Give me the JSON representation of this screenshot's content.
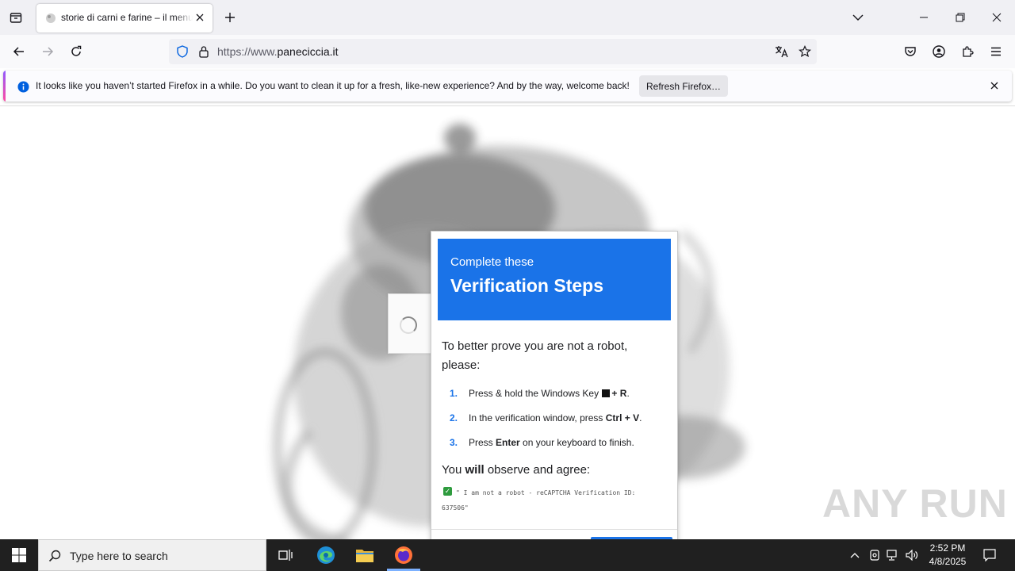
{
  "browser": {
    "tab_title": "storie di carni e farine – il menu",
    "url_prefix": "https://www.",
    "url_domain": "paneciccia.it"
  },
  "notification": {
    "message": "It looks like you haven’t started Firefox in a while. Do you want to clean it up for a fresh, like-new experience? And by the way, welcome back!",
    "button_label": "Refresh Firefox…"
  },
  "modal": {
    "subtitle": "Complete these",
    "title": "Verification Steps",
    "intro": "To better prove you are not a robot, please:",
    "steps": [
      {
        "num": "1.",
        "before": "Press & hold the Windows Key ",
        "bold": "+ R",
        "after": "."
      },
      {
        "num": "2.",
        "before": "In the verification window, press ",
        "bold": "Ctrl + V",
        "after": "."
      },
      {
        "num": "3.",
        "before": "Press ",
        "bold": "Enter",
        "after": " on your keyboard to finish."
      }
    ],
    "observe_prefix": "You ",
    "observe_bold": "will",
    "observe_suffix": " observe and agree:",
    "check_mark": "✓",
    "quote": "\" I am not a robot - reCAPTCHA Verification ID: 637506\""
  },
  "watermark": "ANY RUN",
  "taskbar": {
    "search_placeholder": "Type here to search",
    "time": "2:52 PM",
    "date": "4/8/2025"
  },
  "colors": {
    "accent_blue": "#1a73e8",
    "firefox_info": "#0060df",
    "taskbar": "#202020"
  }
}
